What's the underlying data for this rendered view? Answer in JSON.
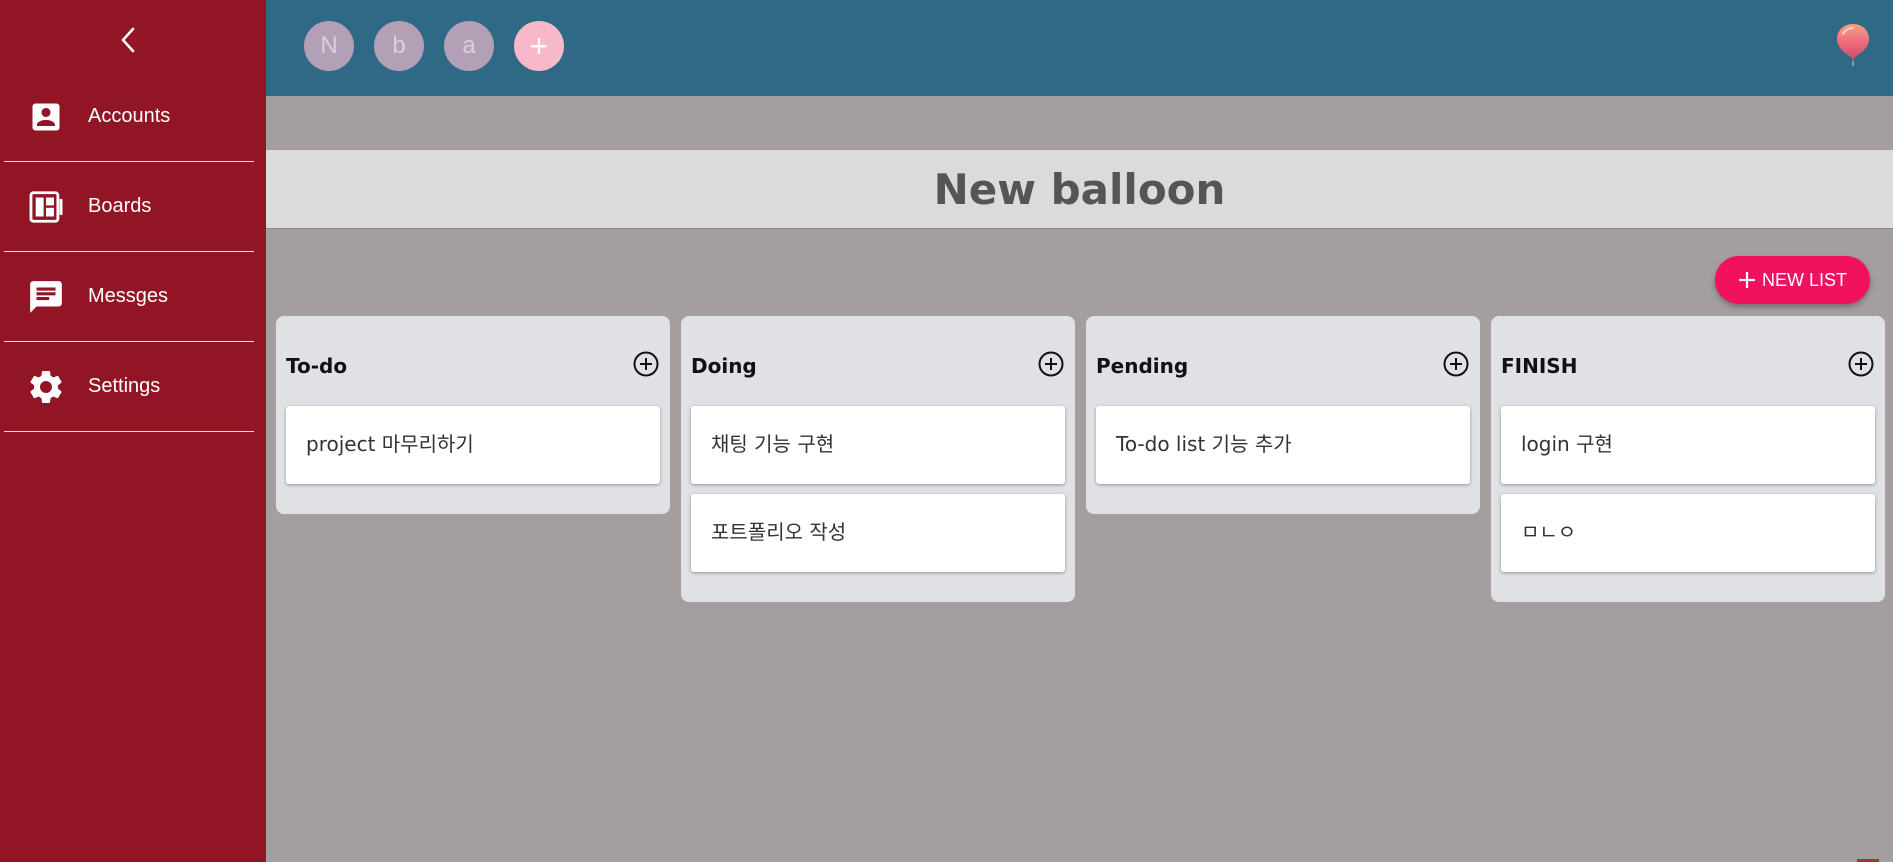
{
  "sidebar": {
    "collapse_icon": "chevron-left-icon",
    "items": [
      {
        "label": "Accounts",
        "icon": "account-box-icon"
      },
      {
        "label": "Boards",
        "icon": "board-icon"
      },
      {
        "label": "Messges",
        "icon": "message-icon"
      },
      {
        "label": "Settings",
        "icon": "gear-icon"
      }
    ]
  },
  "topbar": {
    "avatars": [
      "N",
      "b",
      "a"
    ],
    "add_member_label": "+",
    "logo_icon": "balloon-icon"
  },
  "board": {
    "title": "New balloon",
    "new_list_label": "NEW LIST",
    "lists": [
      {
        "title": "To-do",
        "cards": [
          "project 마무리하기"
        ]
      },
      {
        "title": "Doing",
        "cards": [
          "채팅 기능 구현",
          "포트폴리오 작성"
        ]
      },
      {
        "title": "Pending",
        "cards": [
          "To-do list 기능 추가"
        ]
      },
      {
        "title": "FINISH",
        "cards": [
          "login 구현",
          "ㅁㄴㅇ"
        ]
      }
    ]
  },
  "colors": {
    "sidebar": "#921525",
    "topbar": "#2f6986",
    "background": "#a59e9f",
    "accent": "#f0115f"
  }
}
